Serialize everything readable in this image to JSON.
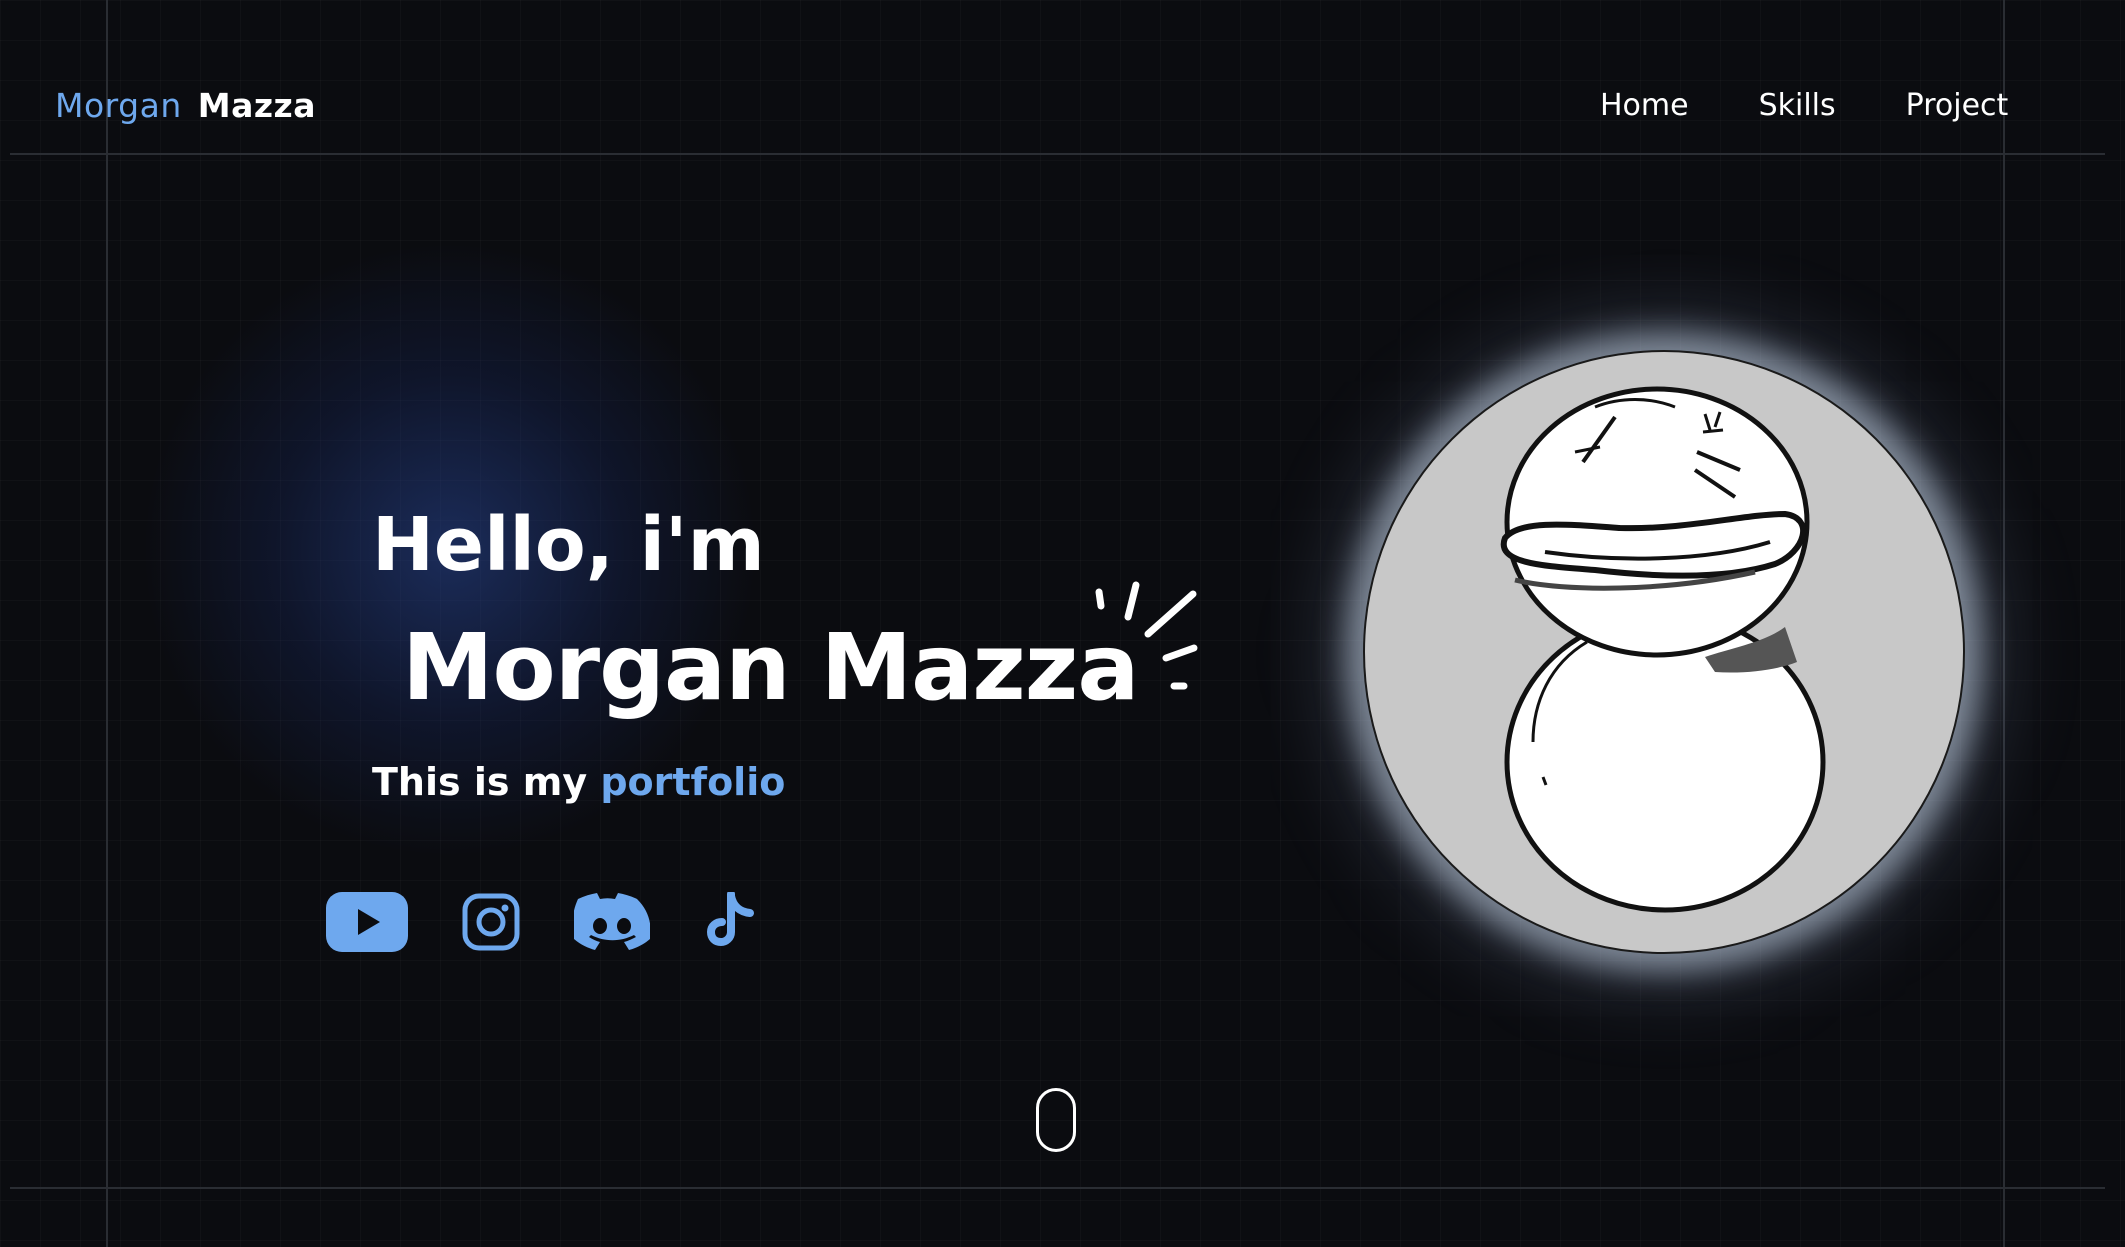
{
  "brand": {
    "first": "Morgan",
    "last": "Mazza"
  },
  "nav": {
    "items": [
      "Home",
      "Skills",
      "Project"
    ]
  },
  "hero": {
    "greeting": "Hello, i'm",
    "name": "Morgan Mazza",
    "tagline_prefix": "This is my ",
    "tagline_highlight": "portfolio"
  },
  "socials": [
    "youtube-icon",
    "instagram-icon",
    "discord-icon",
    "tiktok-icon"
  ],
  "colors": {
    "background": "#0b0c10",
    "accent": "#6ea8ee",
    "text": "#ffffff",
    "avatar_bg": "#c8c8c8"
  }
}
